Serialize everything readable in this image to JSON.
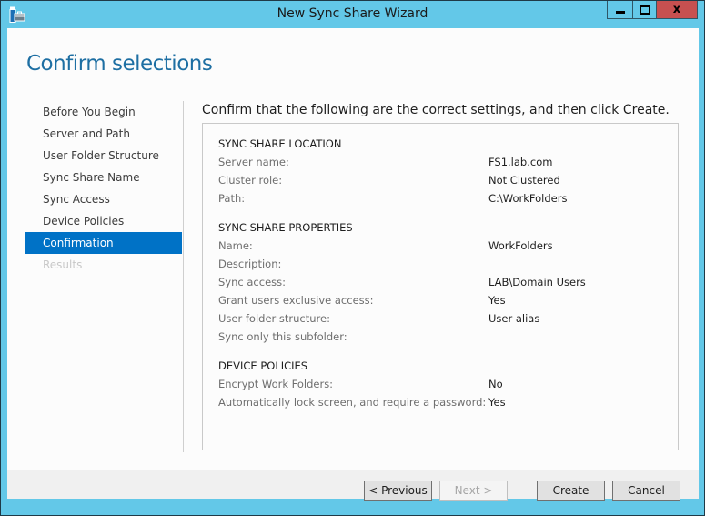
{
  "window": {
    "title": "New Sync Share Wizard",
    "icon": "server-toolbox-icon",
    "controls": {
      "minimize": "minimize-icon",
      "maximize": "maximize-icon",
      "close_glyph": "x"
    }
  },
  "page": {
    "title": "Confirm selections",
    "instruction": "Confirm that the following are the correct settings, and then click Create."
  },
  "nav": {
    "items": [
      {
        "label": "Before You Begin",
        "state": "normal"
      },
      {
        "label": "Server and Path",
        "state": "normal"
      },
      {
        "label": "User Folder Structure",
        "state": "normal"
      },
      {
        "label": "Sync Share Name",
        "state": "normal"
      },
      {
        "label": "Sync Access",
        "state": "normal"
      },
      {
        "label": "Device Policies",
        "state": "normal"
      },
      {
        "label": "Confirmation",
        "state": "active"
      },
      {
        "label": "Results",
        "state": "disabled"
      }
    ]
  },
  "summary": {
    "location": {
      "heading": "SYNC SHARE LOCATION",
      "rows": [
        {
          "label": "Server name:",
          "value": "FS1.lab.com"
        },
        {
          "label": "Cluster role:",
          "value": "Not Clustered"
        },
        {
          "label": "Path:",
          "value": "C:\\WorkFolders"
        }
      ]
    },
    "properties": {
      "heading": "SYNC SHARE PROPERTIES",
      "rows": [
        {
          "label": "Name:",
          "value": "WorkFolders"
        },
        {
          "label": "Description:",
          "value": ""
        },
        {
          "label": "Sync access:",
          "value": "LAB\\Domain Users"
        },
        {
          "label": "Grant users exclusive access:",
          "value": "Yes"
        },
        {
          "label": "User folder structure:",
          "value": "User alias"
        },
        {
          "label": "Sync only this subfolder:",
          "value": ""
        }
      ]
    },
    "policies": {
      "heading": "DEVICE POLICIES",
      "rows": [
        {
          "label": "Encrypt Work Folders:",
          "value": "No"
        },
        {
          "label": "Automatically lock screen, and require a password:",
          "value": "Yes"
        }
      ]
    }
  },
  "buttons": {
    "previous": "< Previous",
    "next": "Next >",
    "create": "Create",
    "cancel": "Cancel"
  }
}
